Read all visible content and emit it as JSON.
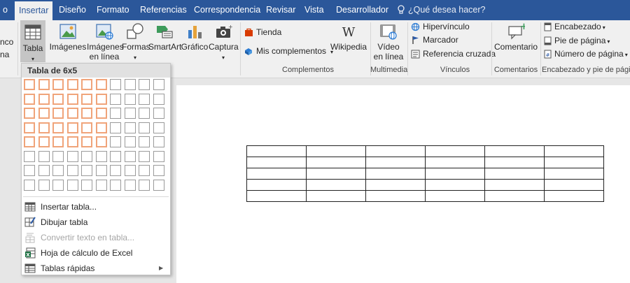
{
  "tabs": [
    {
      "label": "o",
      "active": false
    },
    {
      "label": "Insertar",
      "active": true
    },
    {
      "label": "Diseño",
      "active": false
    },
    {
      "label": "Formato",
      "active": false
    },
    {
      "label": "Referencias",
      "active": false
    },
    {
      "label": "Correspondencia",
      "active": false
    },
    {
      "label": "Revisar",
      "active": false
    },
    {
      "label": "Vista",
      "active": false
    },
    {
      "label": "Desarrollador",
      "active": false
    }
  ],
  "tell_me": "¿Qué desea hacer?",
  "ribbon": {
    "left_partial": [
      "nco",
      "na"
    ],
    "tabla": "Tabla",
    "imagenes": "Imágenes",
    "imagenes_linea": [
      "Imágenes",
      "en línea"
    ],
    "formas": "Formas",
    "smartart": "SmartArt",
    "grafico": "Gráfico",
    "captura": "Captura",
    "tienda": "Tienda",
    "mis_complementos": "Mis complementos",
    "wikipedia": "Wikipedia",
    "video": [
      "Vídeo",
      "en línea"
    ],
    "hipervinculo": "Hipervínculo",
    "marcador": "Marcador",
    "ref_cruzada": "Referencia cruzada",
    "comentario": "Comentario",
    "encabezado": "Encabezado",
    "pie": "Pie de página",
    "numero": "Número de página",
    "groups": {
      "complementos": "Complementos",
      "multimedia": "Multimedia",
      "vinculos": "Vínculos",
      "comentarios": "Comentarios",
      "encabezado_pie": "Encabezado y pie de página"
    }
  },
  "table_menu": {
    "header": "Tabla de 6x5",
    "grid_cols": 10,
    "grid_rows": 8,
    "selected_cols": 6,
    "selected_rows": 5,
    "items": [
      {
        "label": "Insertar tabla...",
        "icon": "insert-table-icon",
        "enabled": true
      },
      {
        "label": "Dibujar tabla",
        "icon": "draw-table-icon",
        "enabled": true
      },
      {
        "label": "Convertir texto en tabla...",
        "icon": "convert-text-icon",
        "enabled": false
      },
      {
        "label": "Hoja de cálculo de Excel",
        "icon": "excel-icon",
        "enabled": true
      },
      {
        "label": "Tablas rápidas",
        "icon": "quick-tables-icon",
        "enabled": true,
        "submenu": true
      }
    ]
  },
  "document": {
    "table_rows": 5,
    "table_cols": 6
  },
  "colors": {
    "accent": "#2b579a",
    "grid_highlight": "#f0a47a"
  }
}
